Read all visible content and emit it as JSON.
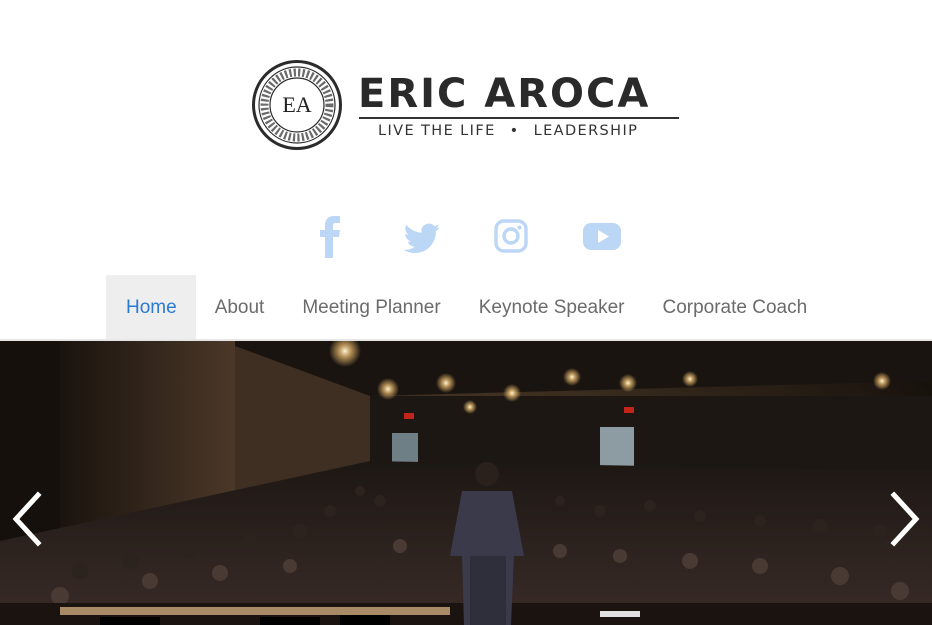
{
  "brand": {
    "monogram": "EA",
    "name": "ERIC AROCA",
    "tagline_left": "LIVE THE LIFE",
    "tagline_separator": "•",
    "tagline_right": "LEADERSHIP"
  },
  "social": {
    "icon_color": "#bcd6f5",
    "items": [
      {
        "name": "facebook-icon"
      },
      {
        "name": "twitter-icon"
      },
      {
        "name": "instagram-icon"
      },
      {
        "name": "youtube-icon"
      }
    ]
  },
  "nav": {
    "active_color": "#2a7ad2",
    "items": [
      {
        "label": "Home",
        "active": true
      },
      {
        "label": "About"
      },
      {
        "label": "Meeting Planner"
      },
      {
        "label": "Keynote Speaker"
      },
      {
        "label": "Corporate Coach"
      }
    ]
  },
  "hero": {
    "slide_image": "speaker-on-stage-facing-audience",
    "prev_icon": "chevron-left-icon",
    "next_icon": "chevron-right-icon"
  }
}
